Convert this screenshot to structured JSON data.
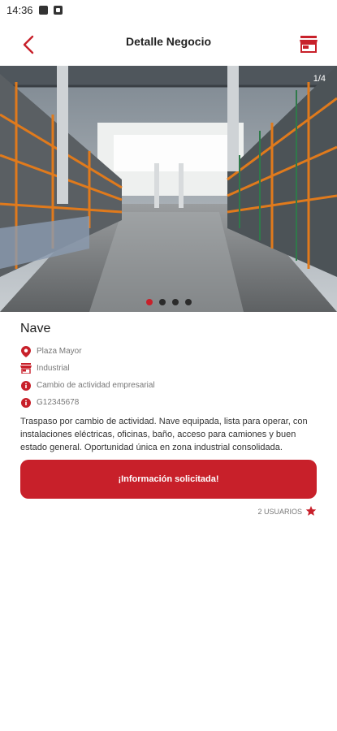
{
  "status_bar": {
    "time": "14:36"
  },
  "header": {
    "title": "Detalle Negocio"
  },
  "gallery": {
    "counter": "1/4",
    "dots": 4,
    "active_dot": 1
  },
  "listing": {
    "name": "Nave",
    "location": "Plaza Mayor",
    "sector": "Industrial",
    "reason": "Cambio de actividad empresarial",
    "reference": "G12345678",
    "description": "Traspaso por cambio de actividad. Nave equipada, lista para operar, con instalaciones eléctricas, oficinas, baño, acceso para camiones y buen estado general. Oportunidad única en zona industrial consolidada."
  },
  "actions": {
    "request_info_label": "¡Información solicitada!"
  },
  "interest": {
    "users_label": "2 USUARIOS"
  },
  "colors": {
    "accent": "#c8202a",
    "text": "#222222",
    "muted": "#777777"
  }
}
